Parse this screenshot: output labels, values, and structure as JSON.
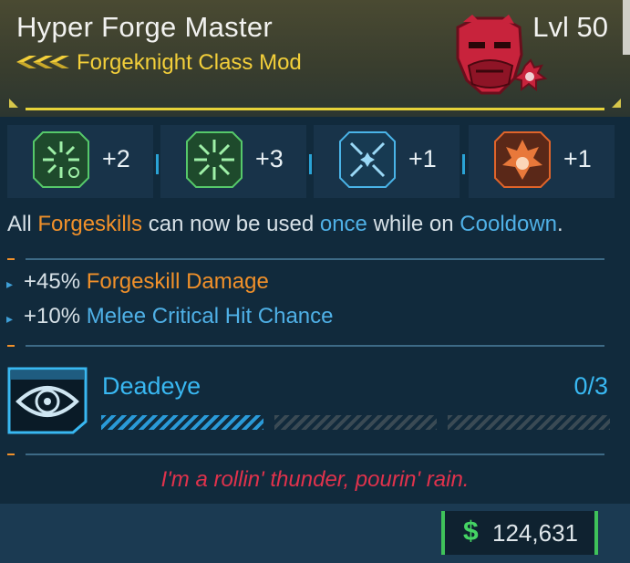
{
  "item": {
    "name": "Hyper Forge Master",
    "level": "Lvl 50",
    "subtitle": "Forgeknight Class Mod",
    "rarity_color": "#f3cf3a",
    "portrait_icon": "red-demon-face-portrait"
  },
  "skills": [
    {
      "icon": "green-splash-timer-icon",
      "value": "+2",
      "color": "#3fbf5a"
    },
    {
      "icon": "green-splash-burst-icon",
      "value": "+3",
      "color": "#3fbf5a"
    },
    {
      "icon": "blue-crosshair-star-icon",
      "value": "+1",
      "color": "#3aa8e0"
    },
    {
      "icon": "orange-fire-burst-icon",
      "value": "+1",
      "color": "#e0642a"
    }
  ],
  "description": {
    "p1": "All ",
    "k1": "Forgeskills",
    "p2": " can now be used ",
    "k2": "once",
    "p3": " while on ",
    "k3": "Cooldown",
    "p4": "."
  },
  "stats": [
    {
      "value": "+45%",
      "label": "Forgeskill Damage",
      "color": "#f0902a"
    },
    {
      "value": "+10%",
      "label": "Melee Critical Hit Chance",
      "color": "#4fb0e6"
    }
  ],
  "passive": {
    "icon": "eye-target-icon",
    "name": "Deadeye",
    "rank": "0/3",
    "ranks_filled": 1,
    "ranks_total": 3
  },
  "flavor_text": "I'm a rollin' thunder, pourin' rain.",
  "price": {
    "symbol": "$",
    "value": "124,631"
  }
}
